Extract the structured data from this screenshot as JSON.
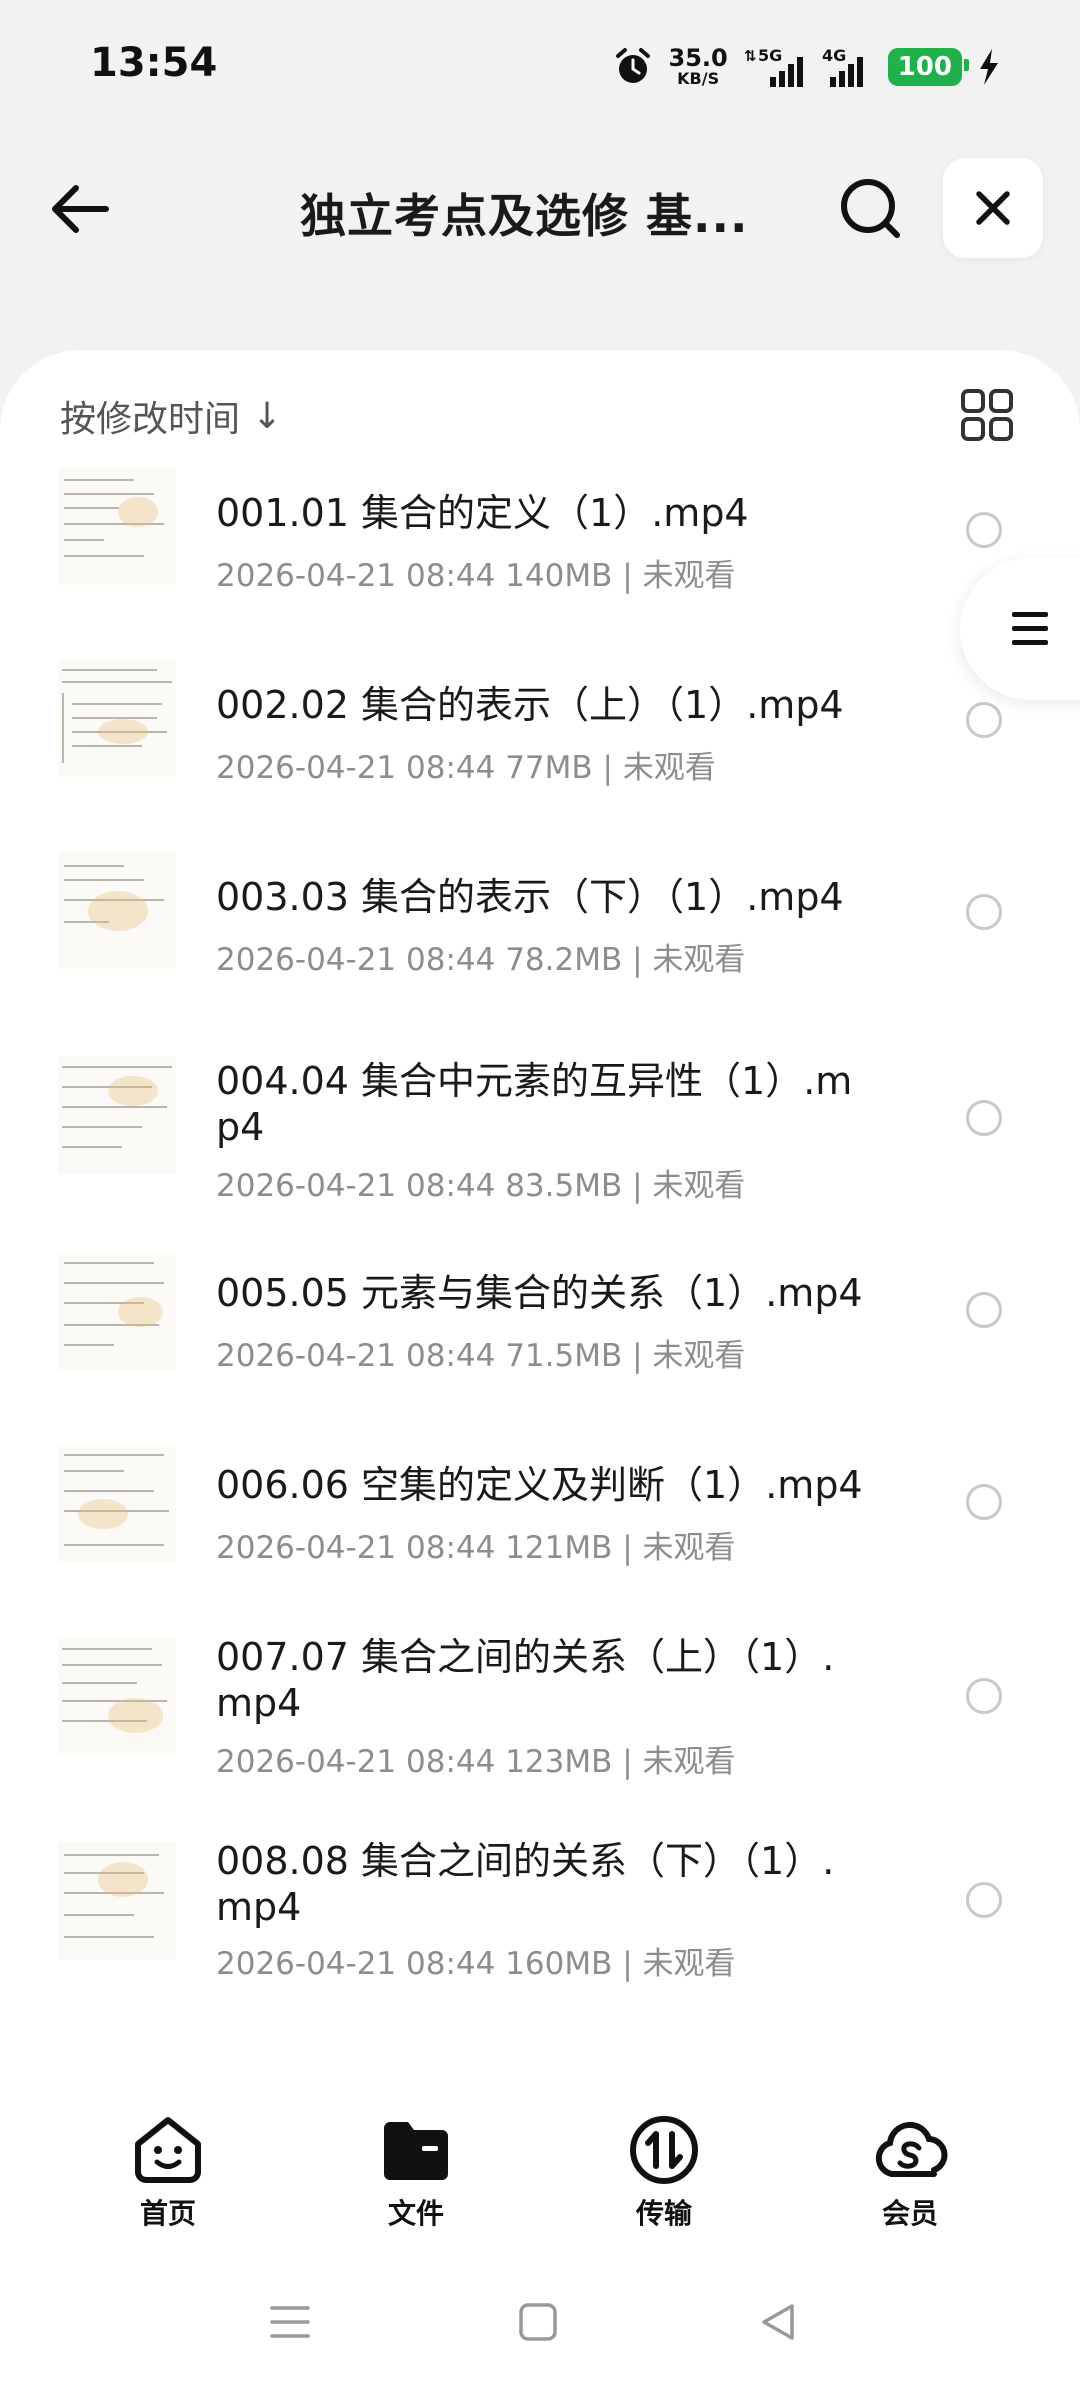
{
  "status": {
    "time": "13:54",
    "speed_value": "35.0",
    "speed_unit": "KB/S",
    "network_1": "5G",
    "network_2": "4G",
    "battery": "100"
  },
  "header": {
    "title": "独立考点及选修 基..."
  },
  "sort": {
    "label": "按修改时间",
    "arrow": "↓"
  },
  "files": [
    {
      "name": "001.01 集合的定义（1）.mp4",
      "meta": "2026-04-21 08:44  140MB | 未观看"
    },
    {
      "name": "002.02 集合的表示（上）（1）.mp4",
      "meta": "2026-04-21 08:44  77MB | 未观看"
    },
    {
      "name": "003.03 集合的表示（下）（1）.mp4",
      "meta": "2026-04-21 08:44  78.2MB | 未观看"
    },
    {
      "name": "004.04 集合中元素的互异性（1）.mp4",
      "meta": "2026-04-21 08:44  83.5MB | 未观看"
    },
    {
      "name": "005.05 元素与集合的关系（1）.mp4",
      "meta": "2026-04-21 08:44  71.5MB | 未观看"
    },
    {
      "name": "006.06 空集的定义及判断（1）.mp4",
      "meta": "2026-04-21 08:44  121MB | 未观看"
    },
    {
      "name": "007.07 集合之间的关系（上）（1）.mp4",
      "meta": "2026-04-21 08:44  123MB | 未观看"
    },
    {
      "name": "008.08 集合之间的关系（下）（1）.mp4",
      "meta": "2026-04-21 08:44  160MB | 未观看"
    }
  ],
  "nav": {
    "home": "首页",
    "files": "文件",
    "transfer": "传输",
    "member": "会员"
  },
  "colors": {
    "battery": "#1fb14a",
    "accent_dark": "#1a1a1a"
  }
}
